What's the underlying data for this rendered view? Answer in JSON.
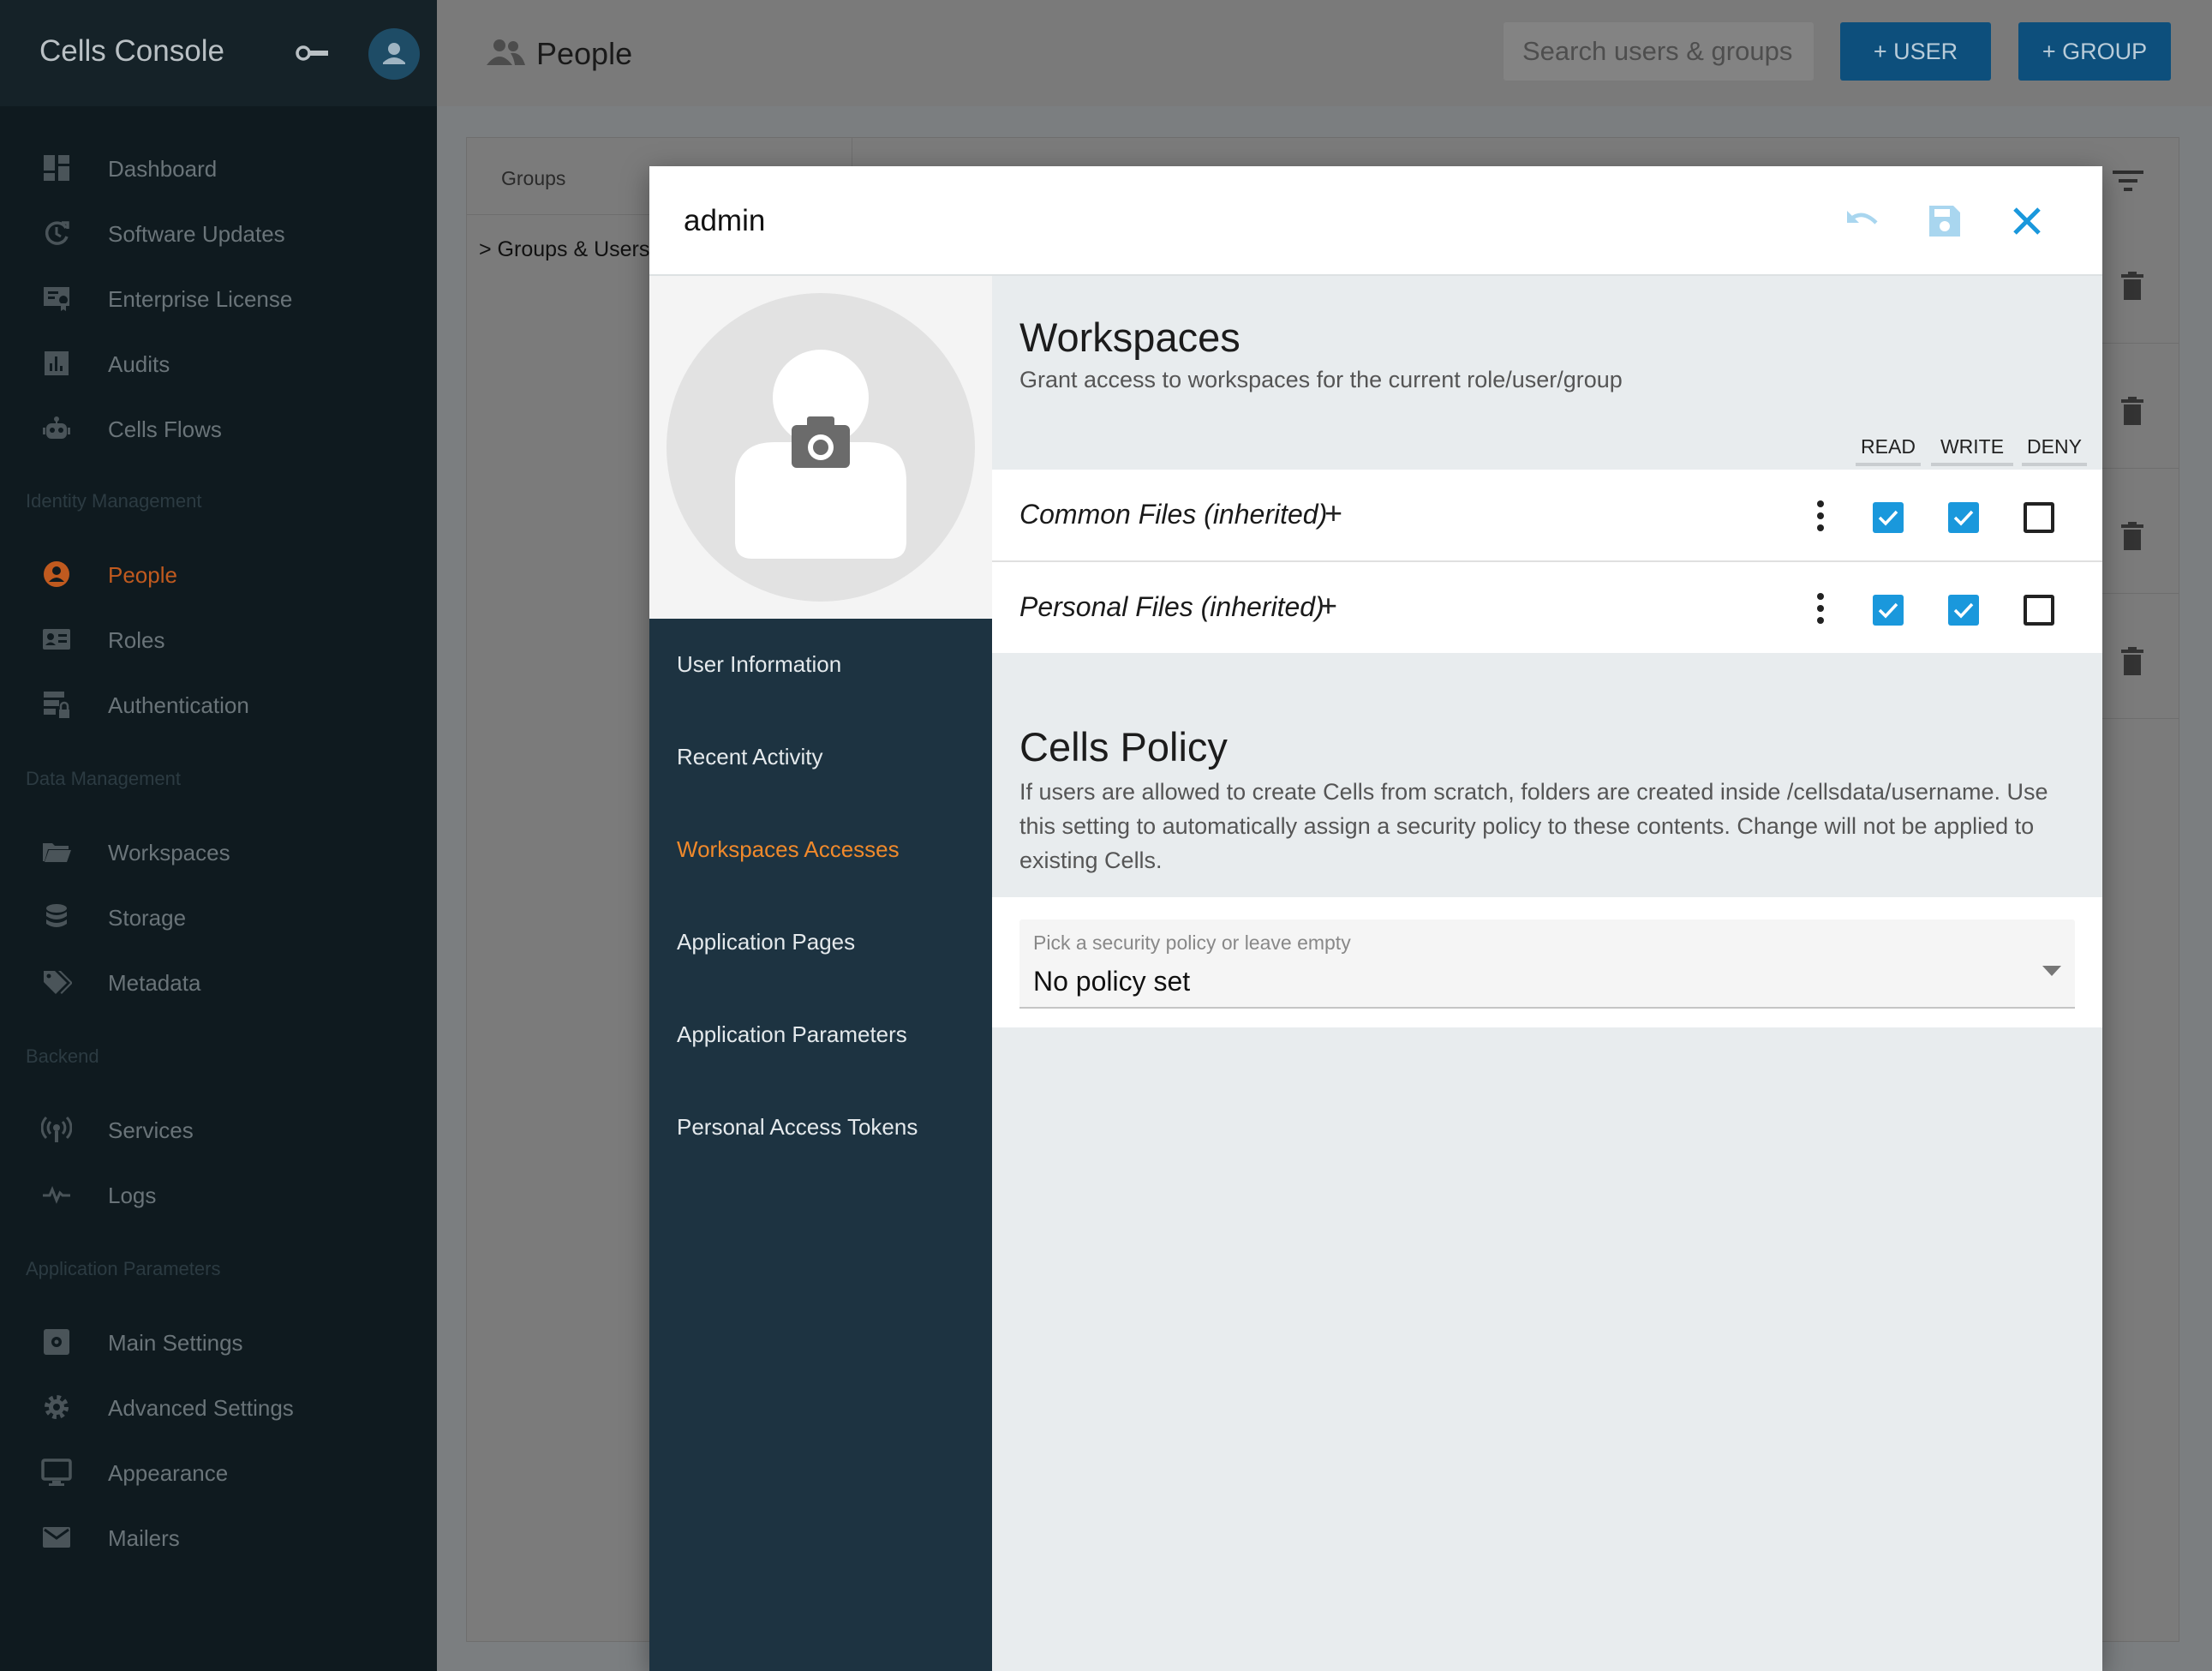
{
  "app": {
    "title": "Cells Console"
  },
  "sidebar": {
    "sections": {
      "identity": "Identity Management",
      "data": "Data Management",
      "backend": "Backend",
      "app_params": "Application Parameters"
    },
    "items": {
      "dashboard": "Dashboard",
      "software_updates": "Software Updates",
      "enterprise_license": "Enterprise License",
      "audits": "Audits",
      "cells_flows": "Cells Flows",
      "people": "People",
      "roles": "Roles",
      "authentication": "Authentication",
      "workspaces": "Workspaces",
      "storage": "Storage",
      "metadata": "Metadata",
      "services": "Services",
      "logs": "Logs",
      "main_settings": "Main Settings",
      "advanced_settings": "Advanced Settings",
      "appearance": "Appearance",
      "mailers": "Mailers"
    },
    "active_item": "people"
  },
  "topbar": {
    "title": "People",
    "search_placeholder": "Search users & groups",
    "add_user_label": "+ USER",
    "add_group_label": "+ GROUP"
  },
  "background": {
    "groups_label": "Groups",
    "tree_item": "> Groups & Users"
  },
  "modal": {
    "title": "admin",
    "menu": {
      "user_information": "User Information",
      "recent_activity": "Recent Activity",
      "workspaces_accesses": "Workspaces Accesses",
      "application_pages": "Application Pages",
      "application_parameters": "Application Parameters",
      "personal_access_tokens": "Personal Access Tokens"
    },
    "active_menu": "workspaces_accesses",
    "workspaces": {
      "title": "Workspaces",
      "subtitle": "Grant access to workspaces for the current role/user/group",
      "columns": {
        "read": "READ",
        "write": "WRITE",
        "deny": "DENY"
      },
      "rows": [
        {
          "name": "Common Files (inherited)",
          "plus": "+",
          "read": true,
          "write": true,
          "deny": false
        },
        {
          "name": "Personal Files (inherited)",
          "plus": "+",
          "read": true,
          "write": true,
          "deny": false
        }
      ]
    },
    "cells_policy": {
      "title": "Cells Policy",
      "description": "If users are allowed to create Cells from scratch, folders are created inside /cellsdata/username. Use this setting to automatically assign a security policy to these contents. Change will not be applied to existing Cells.",
      "select_label": "Pick a security policy or leave empty",
      "select_value": "No policy set"
    }
  },
  "colors": {
    "accent_blue": "#1a98dc",
    "active_orange": "#f0892b",
    "modal_menu_bg": "#1d3341",
    "sidebar_bg": "#0f1a1f"
  }
}
